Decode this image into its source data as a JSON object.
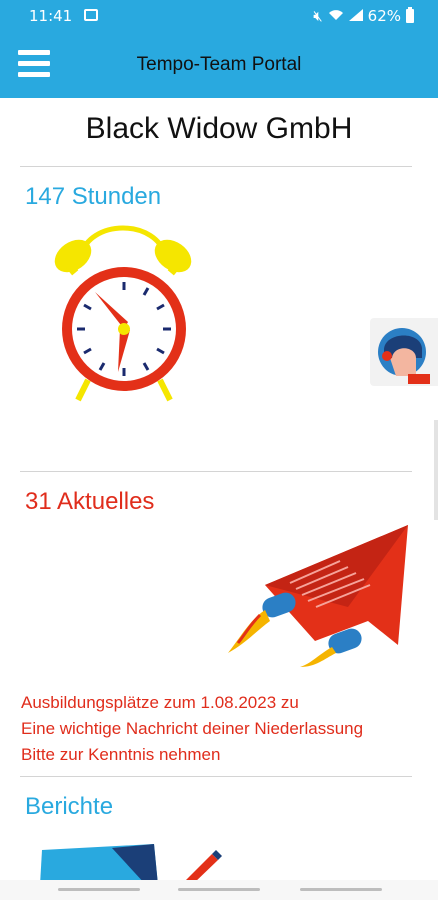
{
  "status_bar": {
    "time": "11:41",
    "battery": "62%",
    "icons": [
      "image-icon",
      "mute-icon",
      "wifi-icon",
      "signal-icon",
      "battery-icon"
    ]
  },
  "app_bar": {
    "title": "Tempo-Team Portal",
    "menu_icon": "hamburger-menu-icon"
  },
  "company": {
    "name": "Black Widow GmbH"
  },
  "hours_card": {
    "title": "147 Stunden",
    "icon": "alarm-clock-icon"
  },
  "news_card": {
    "title": "31 Aktuelles",
    "icon": "paper-plane-icon",
    "items": [
      "Ausbildungsplätze zum 1.08.2023 zu",
      "Eine wichtige Nachricht deiner Niederlassung",
      "Bitte zur Kenntnis nehmen"
    ]
  },
  "reports_card": {
    "title": "Berichte",
    "icon": "report-icon"
  },
  "colors": {
    "accent": "#29a9df",
    "news": "#e02d1c",
    "clock_bell": "#f5e600"
  }
}
